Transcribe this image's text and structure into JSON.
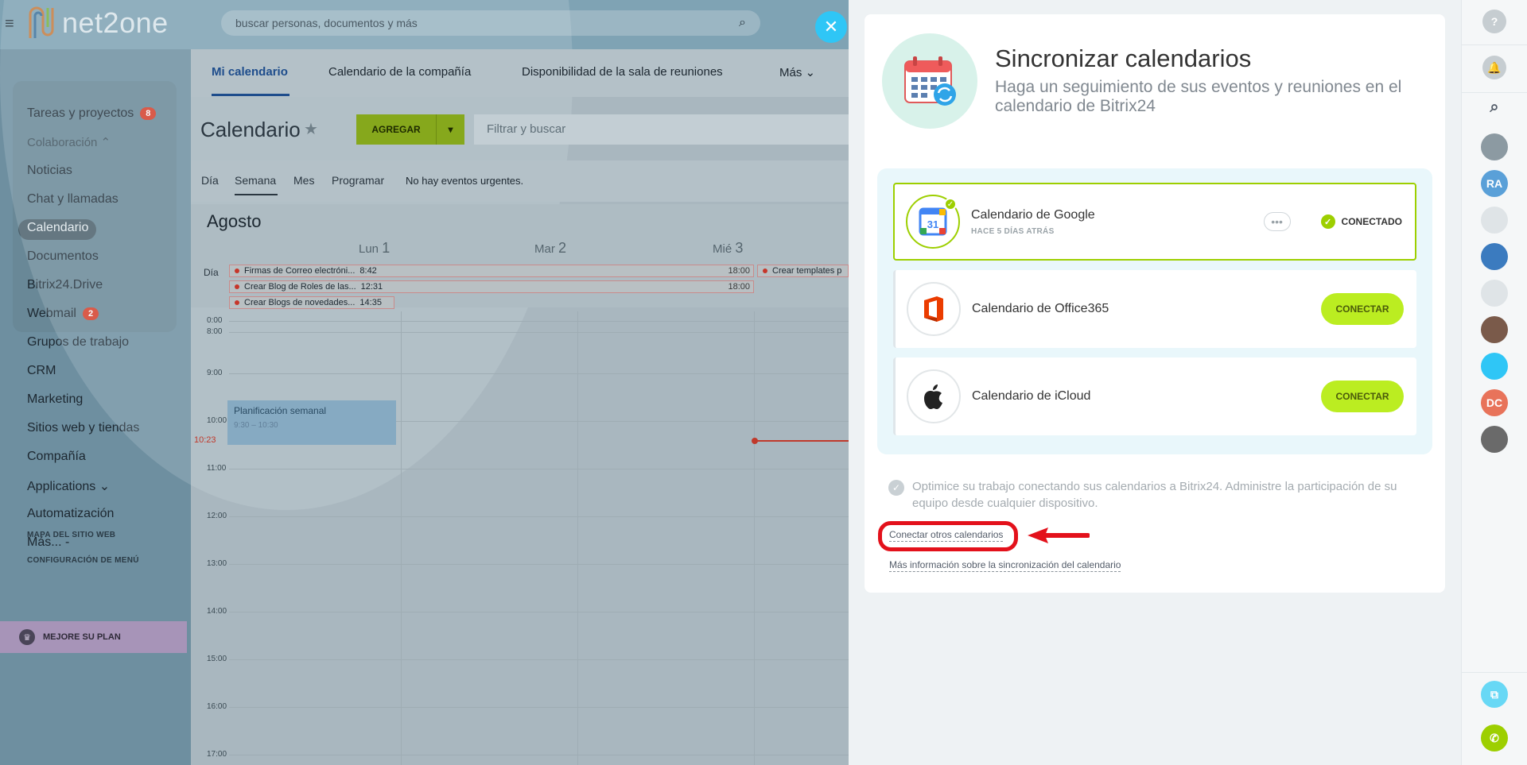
{
  "topbar": {
    "logo_text": "net2one",
    "search_placeholder": "buscar personas, documentos y más"
  },
  "sidebar": {
    "items": [
      {
        "label": "Tareas y proyectos",
        "badge": "8"
      },
      {
        "label": "Colaboración ⌃",
        "badge": ""
      },
      {
        "label": "Noticias",
        "badge": ""
      },
      {
        "label": "Chat y llamadas",
        "badge": ""
      },
      {
        "label": "Calendario",
        "badge": ""
      },
      {
        "label": "Documentos",
        "badge": ""
      },
      {
        "label": "Bitrix24.Drive",
        "badge": ""
      },
      {
        "label": "Webmail",
        "badge": "2"
      },
      {
        "label": "Grupos de trabajo",
        "badge": ""
      },
      {
        "label": "CRM",
        "badge": ""
      },
      {
        "label": "Marketing",
        "badge": ""
      },
      {
        "label": "Sitios web y tiendas",
        "badge": ""
      },
      {
        "label": "Compañía",
        "badge": ""
      },
      {
        "label": "Applications ⌄",
        "badge": ""
      },
      {
        "label": "Automatización",
        "badge": ""
      },
      {
        "label": "Más... -",
        "badge": ""
      }
    ],
    "site_map": "MAPA DEL SITIO WEB",
    "menu_config": "CONFIGURACIÓN DE MENÚ",
    "upgrade": "MEJORE SU PLAN"
  },
  "main": {
    "tabs": [
      "Mi calendario",
      "Calendario de la compañía",
      "Disponibilidad de la sala de reuniones",
      "Más ⌄"
    ],
    "title": "Calendario",
    "add_label": "AGREGAR",
    "filter_placeholder": "Filtrar y buscar",
    "views": [
      "Día",
      "Semana",
      "Mes",
      "Programar"
    ],
    "urgent": "No hay eventos urgentes.",
    "month": "Agosto",
    "days": [
      {
        "name": "Lun",
        "num": "1"
      },
      {
        "name": "Mar",
        "num": "2"
      },
      {
        "name": "Mié",
        "num": "3"
      }
    ],
    "allday_label": "Día",
    "allday_events": [
      {
        "name": "Firmas de Correo electróni...",
        "start": "8:42",
        "end": "18:00"
      },
      {
        "name": "Crear Blog de Roles de las...",
        "start": "12:31",
        "end": "18:00"
      },
      {
        "name": "Crear Blogs de novedades...",
        "start": "14:35",
        "end": ""
      },
      {
        "name": "Crear templates p",
        "start": "",
        "end": ""
      }
    ],
    "hours": [
      "0:00",
      "8:00",
      "9:00",
      "10:00",
      "11:00",
      "12:00",
      "13:00",
      "14:00",
      "15:00",
      "16:00",
      "17:00"
    ],
    "now": "10:23",
    "event": {
      "name": "Planificación semanal",
      "time": "9:30 – 10:30"
    }
  },
  "slider": {
    "title": "Sincronizar calendarios",
    "subtitle": "Haga un seguimiento de sus eventos y reuniones en el calendario de Bitrix24",
    "providers": [
      {
        "name": "Calendario de Google",
        "status": "HACE 5 DÍAS ATRÁS",
        "state": "CONECTADO",
        "icon_date": "31"
      },
      {
        "name": "Calendario de Office365",
        "status": "",
        "state": "CONECTAR"
      },
      {
        "name": "Calendario de iCloud",
        "status": "",
        "state": "CONECTAR"
      }
    ],
    "hint": "Optimice su trabajo conectando sus calendarios a Bitrix24. Administre la participación de su equipo desde cualquier dispositivo.",
    "link_other": "Conectar otros calendarios",
    "link_info": "Más información sobre la sincronización del calendario"
  },
  "rightbar": {
    "help": "?",
    "avatars": [
      "",
      "RA",
      "",
      "",
      "",
      "",
      "",
      "DC",
      ""
    ]
  },
  "colors": {
    "accent_green": "#bbed21",
    "connected_green": "#9dcf00",
    "close_blue": "#2fc6f6",
    "highlight_red": "#e3111b"
  }
}
